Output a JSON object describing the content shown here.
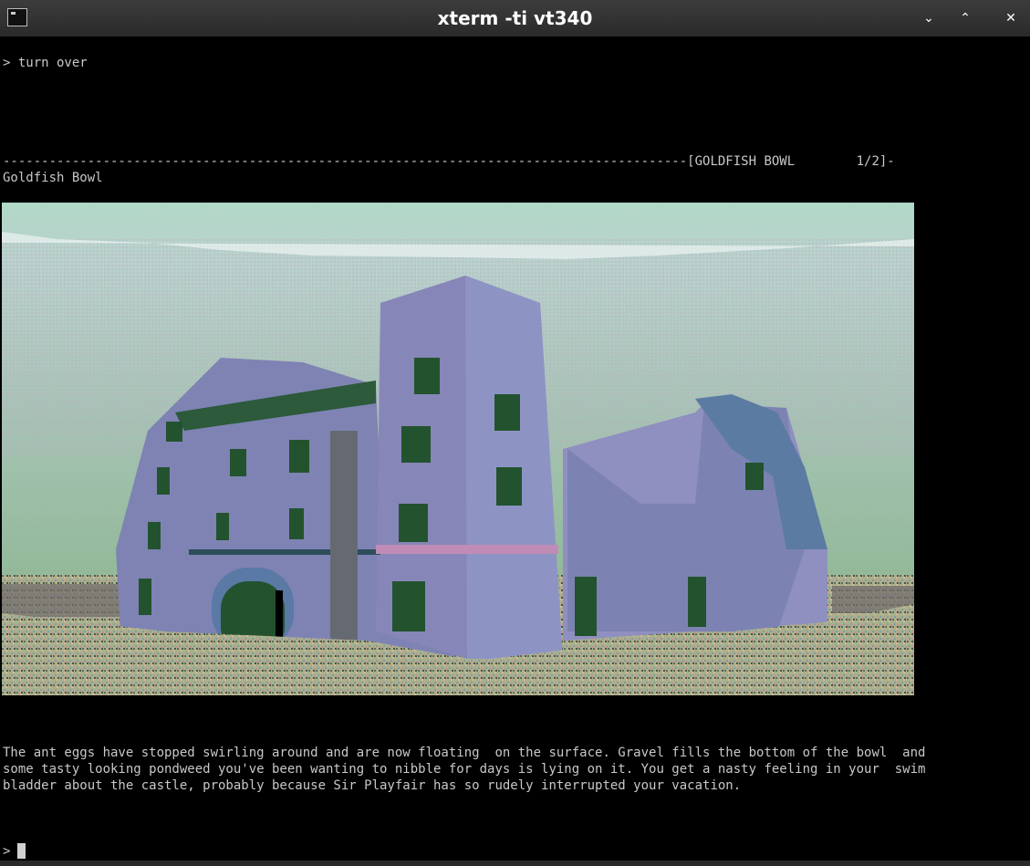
{
  "window": {
    "title": "xterm -ti vt340",
    "icons": [
      "terminal-app-icon",
      "chevron-down-icon",
      "chevron-up-icon",
      "close-icon"
    ],
    "buttons": {
      "minimize": "⌄",
      "maximize": "⌃",
      "close": "✕"
    }
  },
  "terminal": {
    "command_line": "> turn over",
    "status_bar": "-----------------------------------------------------------------------------------------[GOLDFISH BOWL        1/2]-",
    "room_name": "Goldfish Bowl",
    "description": [
      "The ant eggs have stopped swirling around and are now floating  on the surface. Gravel fills the bottom of the bowl  and",
      "some tasty looking pondweed you've been wanting to nibble for days is lying on it. You get a nasty feeling in your  swim",
      "bladder about the castle, probably because Sir Playfair has so rudely interrupted your vacation."
    ],
    "prompt": ">"
  },
  "colors": {
    "background": "#000000",
    "text": "#c8c8c8",
    "titlebar": "#2f2f2f"
  }
}
